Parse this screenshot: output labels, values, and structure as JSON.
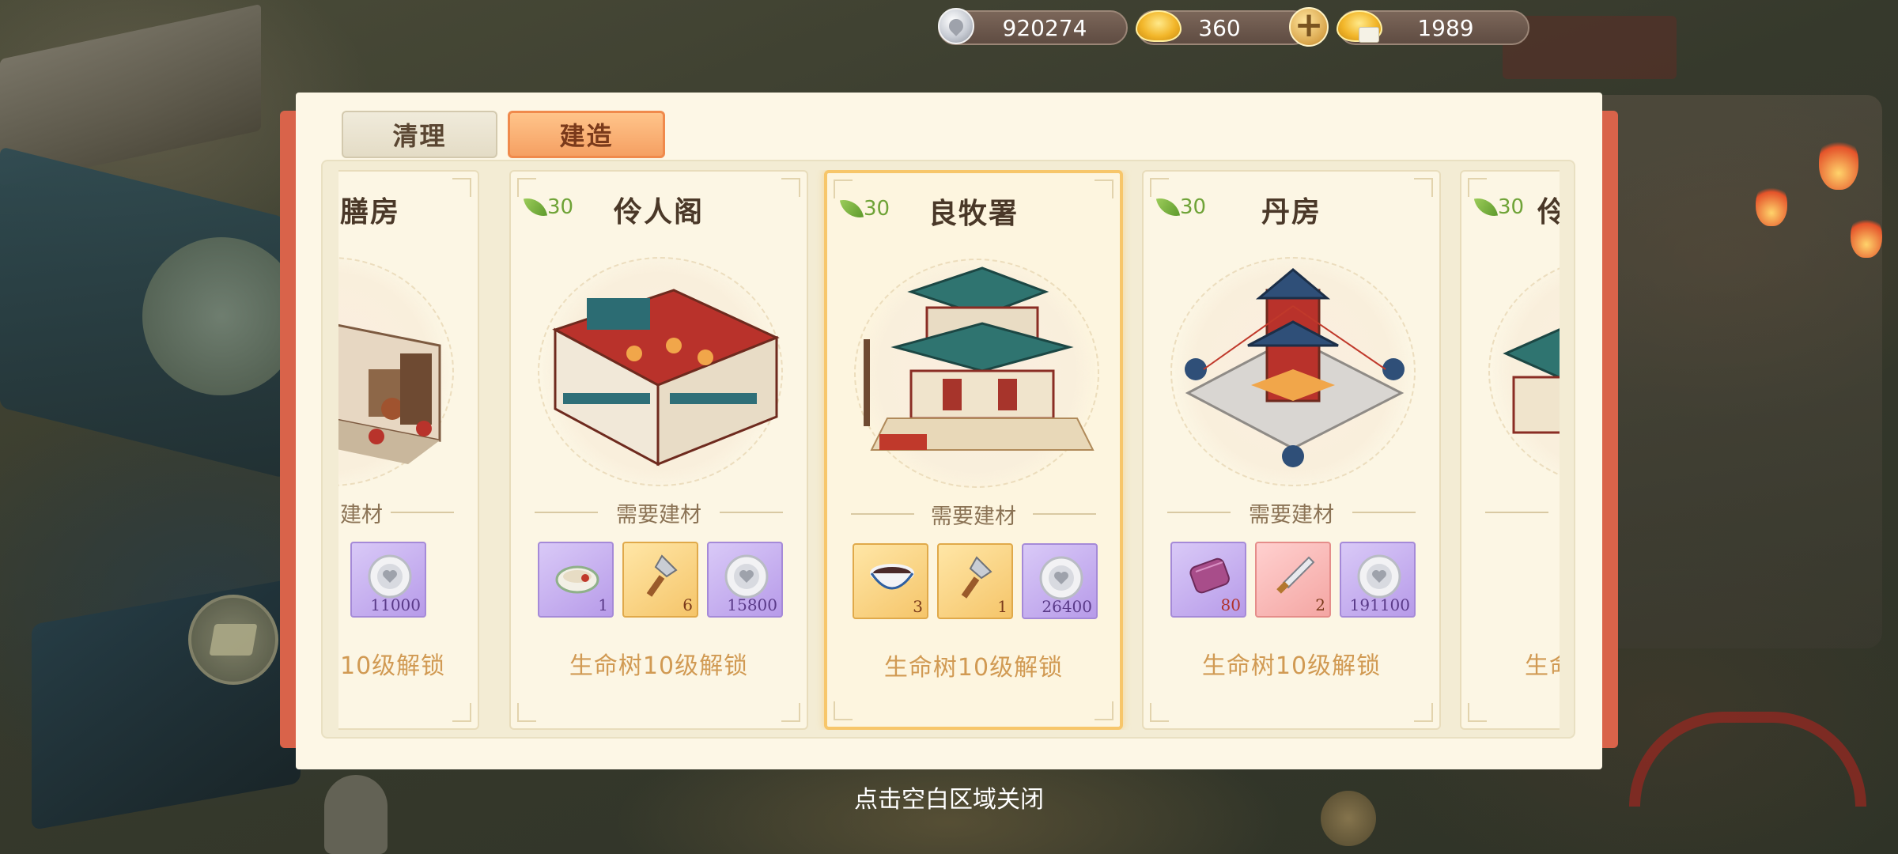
{
  "resources": {
    "silver": "920274",
    "gold_ingot": "360",
    "ticket": "1989",
    "plus_label": "+"
  },
  "tabs": {
    "clean_label": "清理",
    "build_label": "建造"
  },
  "cards": [
    {
      "title": "膳房",
      "leaf": "",
      "need_label": "建材",
      "materials": [
        {
          "type": "silver",
          "qty": "11000"
        }
      ],
      "unlock": "10级解锁"
    },
    {
      "title": "伶人阁",
      "leaf": "30",
      "need_label": "需要建材",
      "materials": [
        {
          "type": "bowl-dish",
          "qty": "1"
        },
        {
          "type": "trowel",
          "qty": "6"
        },
        {
          "type": "silver",
          "qty": "15800"
        }
      ],
      "unlock": "生命树10级解锁"
    },
    {
      "title": "良牧署",
      "leaf": "30",
      "need_label": "需要建材",
      "materials": [
        {
          "type": "soup-bowl",
          "qty": "3"
        },
        {
          "type": "trowel",
          "qty": "1"
        },
        {
          "type": "silver",
          "qty": "26400"
        }
      ],
      "unlock": "生命树10级解锁"
    },
    {
      "title": "丹房",
      "leaf": "30",
      "need_label": "需要建材",
      "materials": [
        {
          "type": "cloth-roll",
          "qty": "80"
        },
        {
          "type": "knife",
          "qty": "2"
        },
        {
          "type": "silver",
          "qty": "191100"
        }
      ],
      "unlock": "生命树10级解锁"
    },
    {
      "title": "伶",
      "leaf": "30",
      "need_label": "",
      "materials": [],
      "unlock": "生命"
    }
  ],
  "close_hint": "点击空白区域关闭",
  "colors": {
    "panel_bg": "#fdf7e6",
    "tab_active": "#f5a063",
    "leaf_green": "#6fa337",
    "unlock_text": "#d19a53",
    "selected_border": "#f7c66a"
  }
}
